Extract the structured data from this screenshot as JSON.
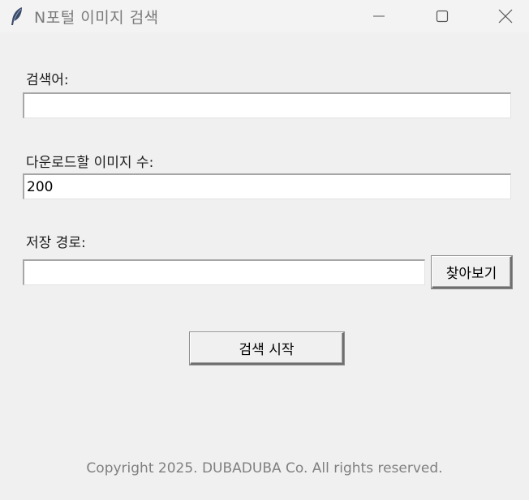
{
  "window": {
    "title": "N포털 이미지 검색",
    "icon": "feather-icon",
    "controls": [
      "minimize-icon",
      "maximize-icon",
      "close-icon"
    ]
  },
  "form": {
    "keyword_label": "검색어:",
    "keyword_value": "",
    "count_label": "다운로드할 이미지 수:",
    "count_value": "200",
    "path_label": "저장 경로:",
    "path_value": "",
    "browse_label": "찾아보기",
    "start_label": "검색 시작"
  },
  "footer": {
    "copyright": "Copyright 2025. DUBADUBA Co. All rights reserved."
  },
  "colors": {
    "background": "#f0f0f0",
    "footer_text": "#808080",
    "title_text": "#7a7a7a"
  }
}
